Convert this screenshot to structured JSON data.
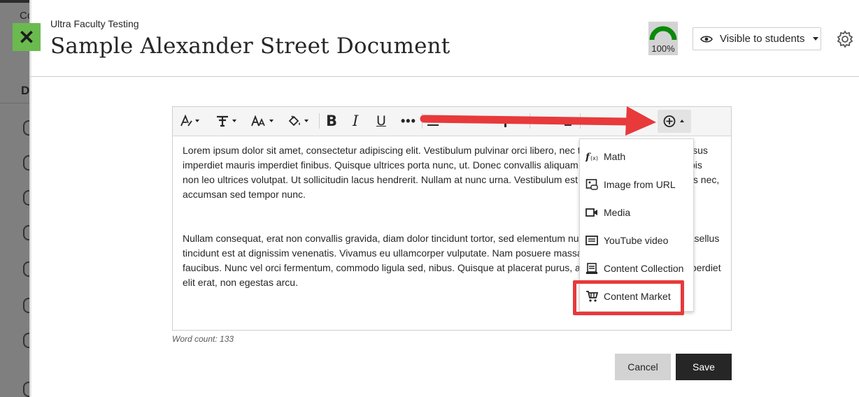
{
  "background": {
    "course_letters": "Co",
    "sidebar_letter": "D"
  },
  "header": {
    "course_name": "Ultra Faculty Testing",
    "title": "Sample Alexander Street Document",
    "progress_text": "100%",
    "progress_value": 1.0,
    "visibility_label": "Visible to students"
  },
  "toolbar": {
    "bold": "B",
    "italic": "I",
    "underline": "U",
    "more": "•••"
  },
  "editor": {
    "paragraphs": [
      " Lorem ipsum dolor sit amet, consectetur adipiscing elit. Vestibulum pulvinar orci libero, nec tincidunt ac. Quisque vel risus imperdiet mauris imperdiet finibus. Quisque ultrices porta nunc, ut. Donec convallis aliquam efficitur. Cras placerat turpis non leo ultrices volutpat. Ut sollicitudin lacus hendrerit. Nullam at nunc urna. Vestibulum est est, faucibus sit amet tellus nec, accumsan sed tempor nunc.",
      "Nullam consequat, erat non convallis gravida, diam dolor tincidunt tortor, sed elementum nunc non consequat elit. Phasellus tincidunt est at dignissim venenatis. Vivamus eu ullamcorper vulputate. Nam posuere massa sit amet dolor venenatis faucibus. Nunc vel orci fermentum, commodo ligula sed, nibus. Quisque at placerat purus, a consequat sem. Proin imperdiet elit erat, non egestas arcu."
    ],
    "word_count": "Word count: 133"
  },
  "insert_menu": {
    "items": [
      {
        "label": "Math",
        "icon": "math-function-icon"
      },
      {
        "label": "Image from URL",
        "icon": "image-url-icon"
      },
      {
        "label": "Media",
        "icon": "video-camera-icon"
      },
      {
        "label": "YouTube video",
        "icon": "youtube-icon"
      },
      {
        "label": "Content Collection",
        "icon": "content-collection-icon"
      },
      {
        "label": "Content Market",
        "icon": "shopping-cart-icon"
      }
    ]
  },
  "buttons": {
    "cancel": "Cancel",
    "save": "Save"
  },
  "colors": {
    "accent_green": "#6bba4f",
    "progress_green": "#0a8a0a",
    "annotation_red": "#e8393b",
    "dark": "#262626"
  }
}
